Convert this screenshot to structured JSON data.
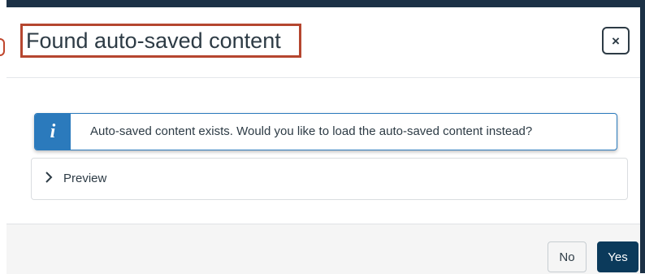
{
  "dialog": {
    "title": "Found auto-saved content",
    "close_label": "×"
  },
  "alert": {
    "icon_glyph": "i",
    "icon_name": "info-icon",
    "message": "Auto-saved content exists. Would you like to load the auto-saved content instead?"
  },
  "preview": {
    "label": "Preview",
    "icon_name": "chevron-right-icon",
    "expanded": false
  },
  "footer": {
    "no_label": "No",
    "yes_label": "Yes"
  },
  "colors": {
    "accent": "#2b7abc",
    "primary_button": "#0b3a5b",
    "highlight_box": "#b5462f",
    "text": "#2d3b45"
  }
}
